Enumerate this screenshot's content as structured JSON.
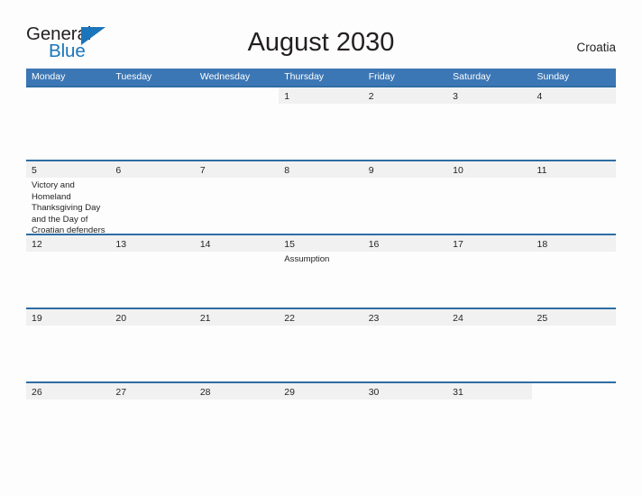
{
  "brand": {
    "line1": "General",
    "line2": "Blue",
    "flag_icon": "flag-triangle-icon",
    "accent_color": "#1b75bb"
  },
  "header": {
    "title": "August 2030",
    "country": "Croatia"
  },
  "theme": {
    "header_blue": "#3c77b5",
    "row_divider_blue": "#2e6da4",
    "band_gray": "#f1f1f1",
    "text_dark": "#231f20",
    "page_background": "#fdfdfd"
  },
  "calendar": {
    "weekdays": [
      "Monday",
      "Tuesday",
      "Wednesday",
      "Thursday",
      "Friday",
      "Saturday",
      "Sunday"
    ],
    "weeks": [
      [
        {
          "day": "",
          "event": ""
        },
        {
          "day": "",
          "event": ""
        },
        {
          "day": "",
          "event": ""
        },
        {
          "day": "1",
          "event": ""
        },
        {
          "day": "2",
          "event": ""
        },
        {
          "day": "3",
          "event": ""
        },
        {
          "day": "4",
          "event": ""
        }
      ],
      [
        {
          "day": "5",
          "event": "Victory and Homeland Thanksgiving Day and the Day of Croatian defenders"
        },
        {
          "day": "6",
          "event": ""
        },
        {
          "day": "7",
          "event": ""
        },
        {
          "day": "8",
          "event": ""
        },
        {
          "day": "9",
          "event": ""
        },
        {
          "day": "10",
          "event": ""
        },
        {
          "day": "11",
          "event": ""
        }
      ],
      [
        {
          "day": "12",
          "event": ""
        },
        {
          "day": "13",
          "event": ""
        },
        {
          "day": "14",
          "event": ""
        },
        {
          "day": "15",
          "event": "Assumption"
        },
        {
          "day": "16",
          "event": ""
        },
        {
          "day": "17",
          "event": ""
        },
        {
          "day": "18",
          "event": ""
        }
      ],
      [
        {
          "day": "19",
          "event": ""
        },
        {
          "day": "20",
          "event": ""
        },
        {
          "day": "21",
          "event": ""
        },
        {
          "day": "22",
          "event": ""
        },
        {
          "day": "23",
          "event": ""
        },
        {
          "day": "24",
          "event": ""
        },
        {
          "day": "25",
          "event": ""
        }
      ],
      [
        {
          "day": "26",
          "event": ""
        },
        {
          "day": "27",
          "event": ""
        },
        {
          "day": "28",
          "event": ""
        },
        {
          "day": "29",
          "event": ""
        },
        {
          "day": "30",
          "event": ""
        },
        {
          "day": "31",
          "event": ""
        },
        {
          "day": "",
          "event": ""
        }
      ]
    ]
  }
}
